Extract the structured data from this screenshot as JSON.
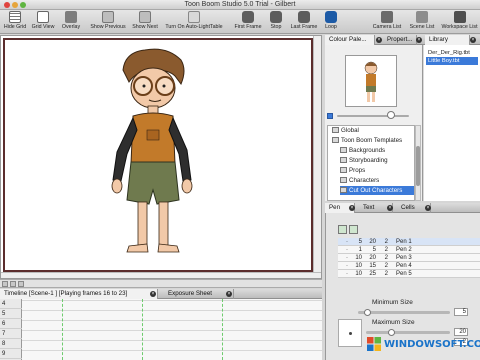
{
  "window": {
    "title": "Toon Boom Studio 5.0 Trial - Gilbert"
  },
  "toolbar": {
    "items": [
      {
        "label": "Hide Grid",
        "icon": "grid-icon"
      },
      {
        "label": "Grid View",
        "icon": "grid-view-icon"
      },
      {
        "label": "Overlay",
        "icon": "overlay-icon"
      },
      {
        "label": "Show Previous",
        "icon": "show-previous-icon"
      },
      {
        "label": "Show Next",
        "icon": "show-next-icon"
      },
      {
        "label": "Turn On Auto-LightTable",
        "icon": "light-table-icon"
      },
      {
        "label": "First Frame",
        "icon": "first-frame-icon"
      },
      {
        "label": "Stop",
        "icon": "stop-icon"
      },
      {
        "label": "Last Frame",
        "icon": "last-frame-icon"
      },
      {
        "label": "Loop",
        "icon": "loop-icon"
      },
      {
        "label": "Camera List",
        "icon": "camera-list-icon"
      },
      {
        "label": "Scene List",
        "icon": "scene-list-icon"
      },
      {
        "label": "Workspace List",
        "icon": "workspace-list-icon"
      }
    ]
  },
  "right_tabs": {
    "colour_palette": "Colour Pale...",
    "properties": "Propert...",
    "library": "Library"
  },
  "library": {
    "items": [
      "Der_Der_Rig.tbt",
      "Little Boy.tbt"
    ],
    "selected_index": 1
  },
  "tree": {
    "items": [
      {
        "label": "Global",
        "indent": 0
      },
      {
        "label": "Toon Boom Templates",
        "indent": 0
      },
      {
        "label": "Backgrounds",
        "indent": 1
      },
      {
        "label": "Storyboarding",
        "indent": 1
      },
      {
        "label": "Props",
        "indent": 1
      },
      {
        "label": "Characters",
        "indent": 1
      },
      {
        "label": "Cut Out Characters",
        "indent": 1,
        "selected": true
      }
    ]
  },
  "bottom_tabs": {
    "timeline": "Timeline [Scene-1 ] [Playing frames 16 to 23]",
    "exposure_sheet": "Exposure Sheet"
  },
  "timeline": {
    "rows": [
      "4",
      "5",
      "6",
      "7",
      "8",
      "9"
    ]
  },
  "pen_panel": {
    "tabs": [
      "Pen",
      "Text",
      "Cells"
    ],
    "pens": [
      {
        "min": "5",
        "max": "20",
        "n": "2",
        "name": "Pen 1"
      },
      {
        "min": "1",
        "max": "5",
        "n": "2",
        "name": "Pen 2"
      },
      {
        "min": "10",
        "max": "20",
        "n": "2",
        "name": "Pen 3"
      },
      {
        "min": "10",
        "max": "15",
        "n": "2",
        "name": "Pen 4"
      },
      {
        "min": "10",
        "max": "25",
        "n": "2",
        "name": "Pen 5"
      }
    ],
    "minimum_size_label": "Minimum Size",
    "minimum_size_value": "5",
    "maximum_size_label": "Maximum Size",
    "maximum_size_value": "20",
    "third_value": "2"
  },
  "watermark": {
    "text_main": "WIN",
    "text_rest": "DOWSOFT.COM"
  },
  "colors": {
    "accent": "#3b7ad9",
    "stage_border": "#5b2d2d",
    "timeline_marker": "#6fcb6f"
  }
}
